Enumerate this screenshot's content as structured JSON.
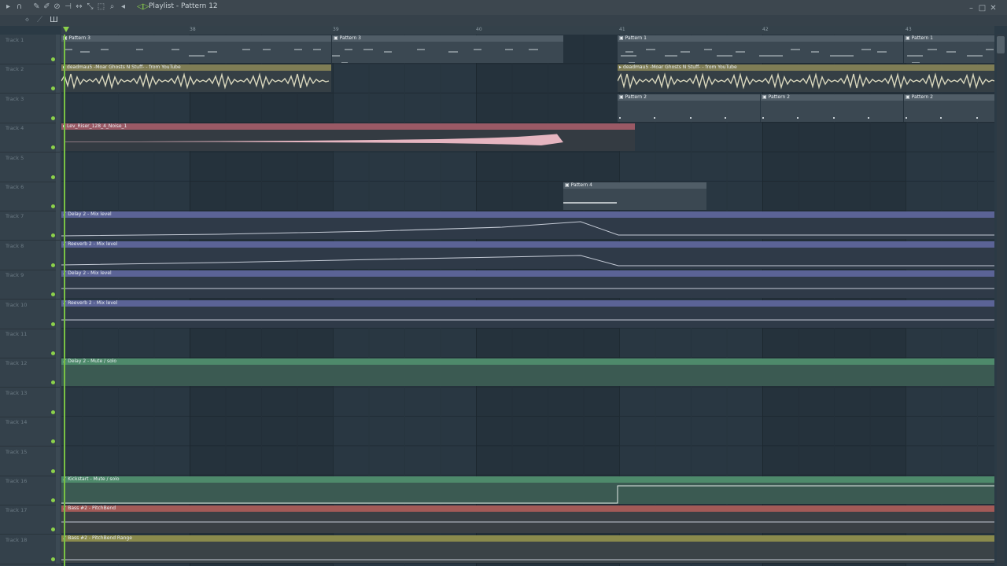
{
  "window": {
    "title": "Playlist - Pattern 12"
  },
  "ruler": {
    "bars": [
      "38",
      "39",
      "40",
      "41",
      "42",
      "43"
    ]
  },
  "tracks": [
    "Track 1",
    "Track 2",
    "Track 3",
    "Track 4",
    "Track 5",
    "Track 6",
    "Track 7",
    "Track 8",
    "Track 9",
    "Track 10",
    "Track 11",
    "Track 12",
    "Track 13",
    "Track 14",
    "Track 15",
    "Track 16",
    "Track 17",
    "Track 18"
  ],
  "clips": {
    "pattern3": "Pattern 3",
    "pattern1": "Pattern 1",
    "pattern2": "Pattern 2",
    "pattern4": "Pattern 4",
    "audio_deadmau5": "deadmau5 -Moar Ghosts N Stuff- - from YouTube",
    "riser": "Lev_Riser_128_4_Noise_1",
    "delay_mix": "Delay 2 - Mix level",
    "reverb_mix": "Reeverb 2 - Mix level",
    "delay_mute": "Delay 2 - Mute / solo",
    "kickstart_mute": "Kickstart - Mute / solo",
    "bass_pitch": "Bass #2 - PitchBend",
    "bass_pitch_range": "Bass #2 - PitchBend Range"
  },
  "colors": {
    "accent": "#8cd14b",
    "automation_blue": "#5b6396",
    "automation_green": "#4e8a6b",
    "automation_red": "#a35a57",
    "audio_olive": "#7f7d55",
    "riser_pink": "#9a5965"
  }
}
